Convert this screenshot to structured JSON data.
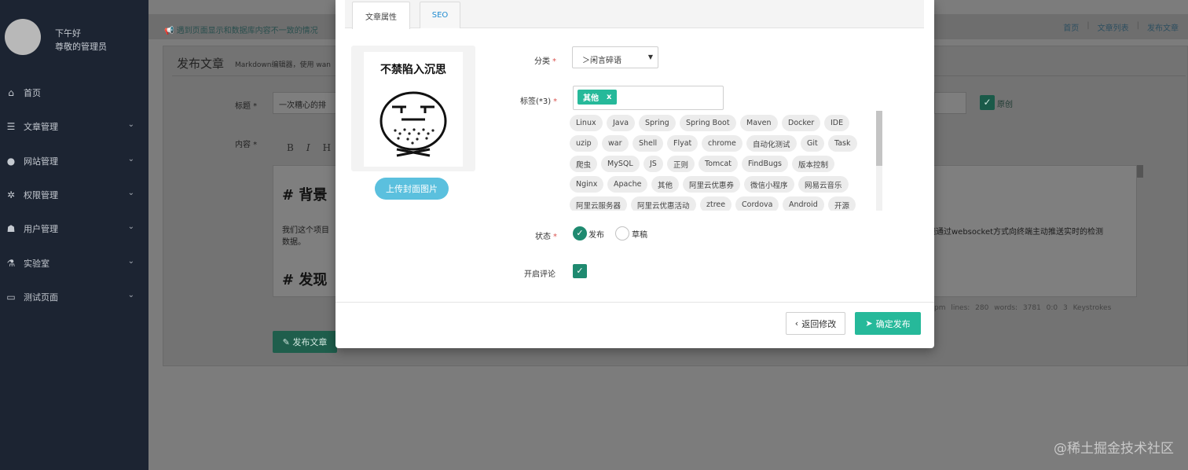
{
  "sidebar": {
    "greeting_line1": "下午好",
    "greeting_line2": "尊敬的管理员",
    "items": [
      {
        "label": "首页",
        "icon": "home-icon",
        "has_chevron": false
      },
      {
        "label": "文章管理",
        "icon": "list-icon",
        "has_chevron": true
      },
      {
        "label": "网站管理",
        "icon": "globe-icon",
        "has_chevron": true
      },
      {
        "label": "权限管理",
        "icon": "cogs-icon",
        "has_chevron": true
      },
      {
        "label": "用户管理",
        "icon": "users-icon",
        "has_chevron": true
      },
      {
        "label": "实验室",
        "icon": "flask-icon",
        "has_chevron": true
      },
      {
        "label": "测试页面",
        "icon": "desktop-icon",
        "has_chevron": true
      }
    ]
  },
  "page": {
    "notice": "遇到页面显示和数据库内容不一致的情况",
    "breadcrumbs": [
      "首页",
      "文章列表",
      "发布文章"
    ],
    "title": "发布文章",
    "subtitle": "Markdown编辑器，使用 wan",
    "title_label": "标题 *",
    "title_value": "一次糟心的排",
    "content_label": "内容 *",
    "toolbar": [
      "B",
      "I",
      "H"
    ],
    "original_label": "原创",
    "editor_heading1": "# 背景",
    "editor_para": "我们这个项目",
    "editor_para2": "数据。",
    "editor_heading2": "# 发现",
    "editor_right_text": "端通过websocket方式向终端主动推送实时的检测",
    "editor_right_highlight": "测",
    "statusbar": "pm   lines: 280   words: 3781     0:0   3 Keystrokes",
    "publish_button": "发布文章"
  },
  "modal": {
    "tabs": [
      "文章属性",
      "SEO"
    ],
    "cover_caption": "不禁陷入沉思",
    "upload_button": "上传封面图片",
    "category_label": "分类",
    "category_value": "＞闲言碎语",
    "tags_label": "标签(*3)",
    "selected_tag": "其他",
    "selected_tag_remove": "x",
    "tag_pool": [
      [
        "Linux",
        "Java",
        "Spring",
        "Spring Boot",
        "Maven",
        "Docker",
        "IDE"
      ],
      [
        "uzip",
        "war",
        "Shell",
        "Flyat",
        "chrome",
        "自动化测试",
        "Git",
        "Task"
      ],
      [
        "爬虫",
        "MySQL",
        "JS",
        "正则",
        "Tomcat",
        "FindBugs",
        "版本控制"
      ],
      [
        "Nginx",
        "Apache",
        "其他",
        "阿里云优惠券",
        "微信小程序",
        "网易云音乐"
      ],
      [
        "阿里云服务器",
        "阿里云优惠活动",
        "ztree",
        "Cordova",
        "Android",
        "开源"
      ]
    ],
    "status_label": "状态",
    "status_options": [
      "发布",
      "草稿"
    ],
    "comment_label": "开启评论",
    "back_button": "返回修改",
    "confirm_button": "确定发布"
  },
  "watermark": "@稀土掘金技术社区",
  "colors": {
    "accent": "#26b99a",
    "info": "#5bc0de",
    "required": "#d9534f",
    "sidebar_bg": "#1c2432"
  }
}
